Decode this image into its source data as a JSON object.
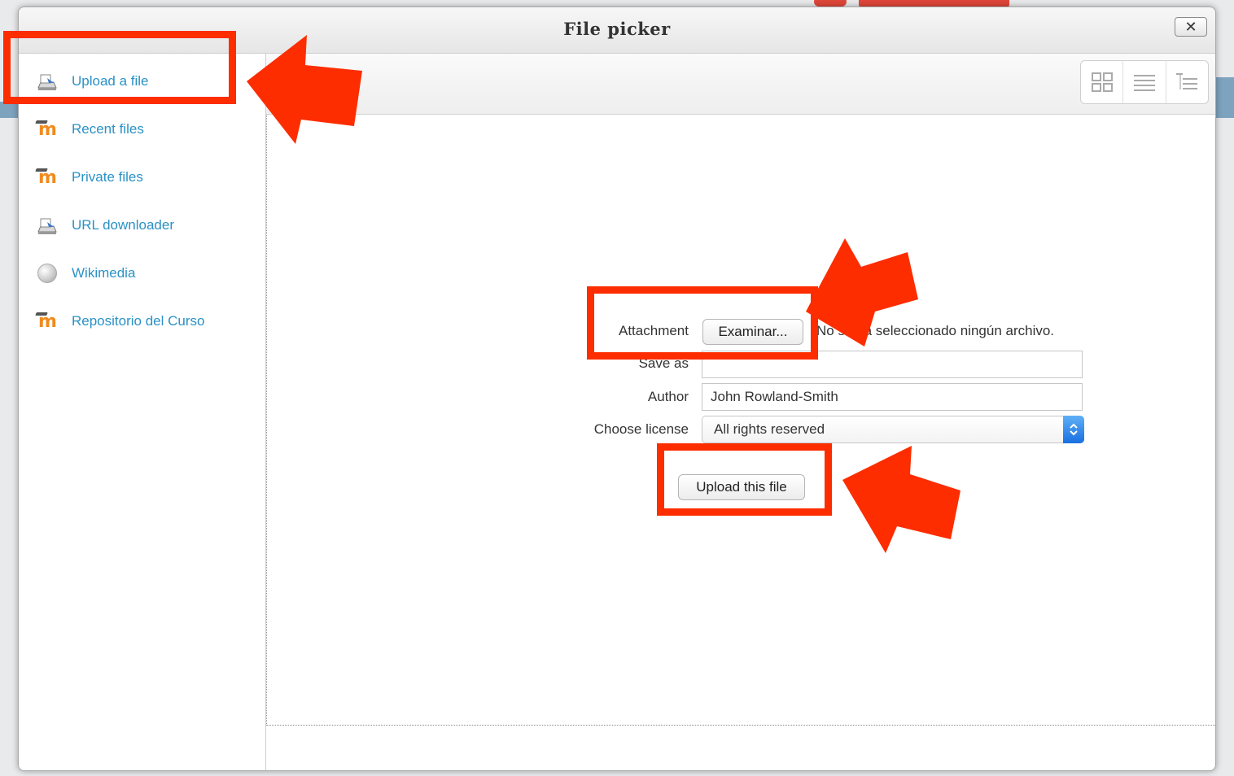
{
  "dialog": {
    "title": "File picker",
    "close_symbol": "✕"
  },
  "sidebar": {
    "items": [
      {
        "label": "Upload a file",
        "icon": "upload-icon"
      },
      {
        "label": "Recent files",
        "icon": "moodle-icon"
      },
      {
        "label": "Private files",
        "icon": "moodle-icon"
      },
      {
        "label": "URL downloader",
        "icon": "upload-icon"
      },
      {
        "label": "Wikimedia",
        "icon": "wikimedia-globe-icon"
      },
      {
        "label": "Repositorio del Curso",
        "icon": "moodle-icon"
      }
    ]
  },
  "toolbar": {
    "views": [
      "icons-view-icon",
      "list-view-icon",
      "tree-view-icon"
    ]
  },
  "form": {
    "attachment_label": "Attachment",
    "browse_button": "Examinar...",
    "no_file_text": "No se ha seleccionado ningún archivo.",
    "saveas_label": "Save as",
    "saveas_value": "",
    "author_label": "Author",
    "author_value": "John Rowland-Smith",
    "license_label": "Choose license",
    "license_value": "All rights reserved",
    "upload_button": "Upload this file"
  },
  "annotations": {
    "highlight_color": "#fd2d00"
  }
}
